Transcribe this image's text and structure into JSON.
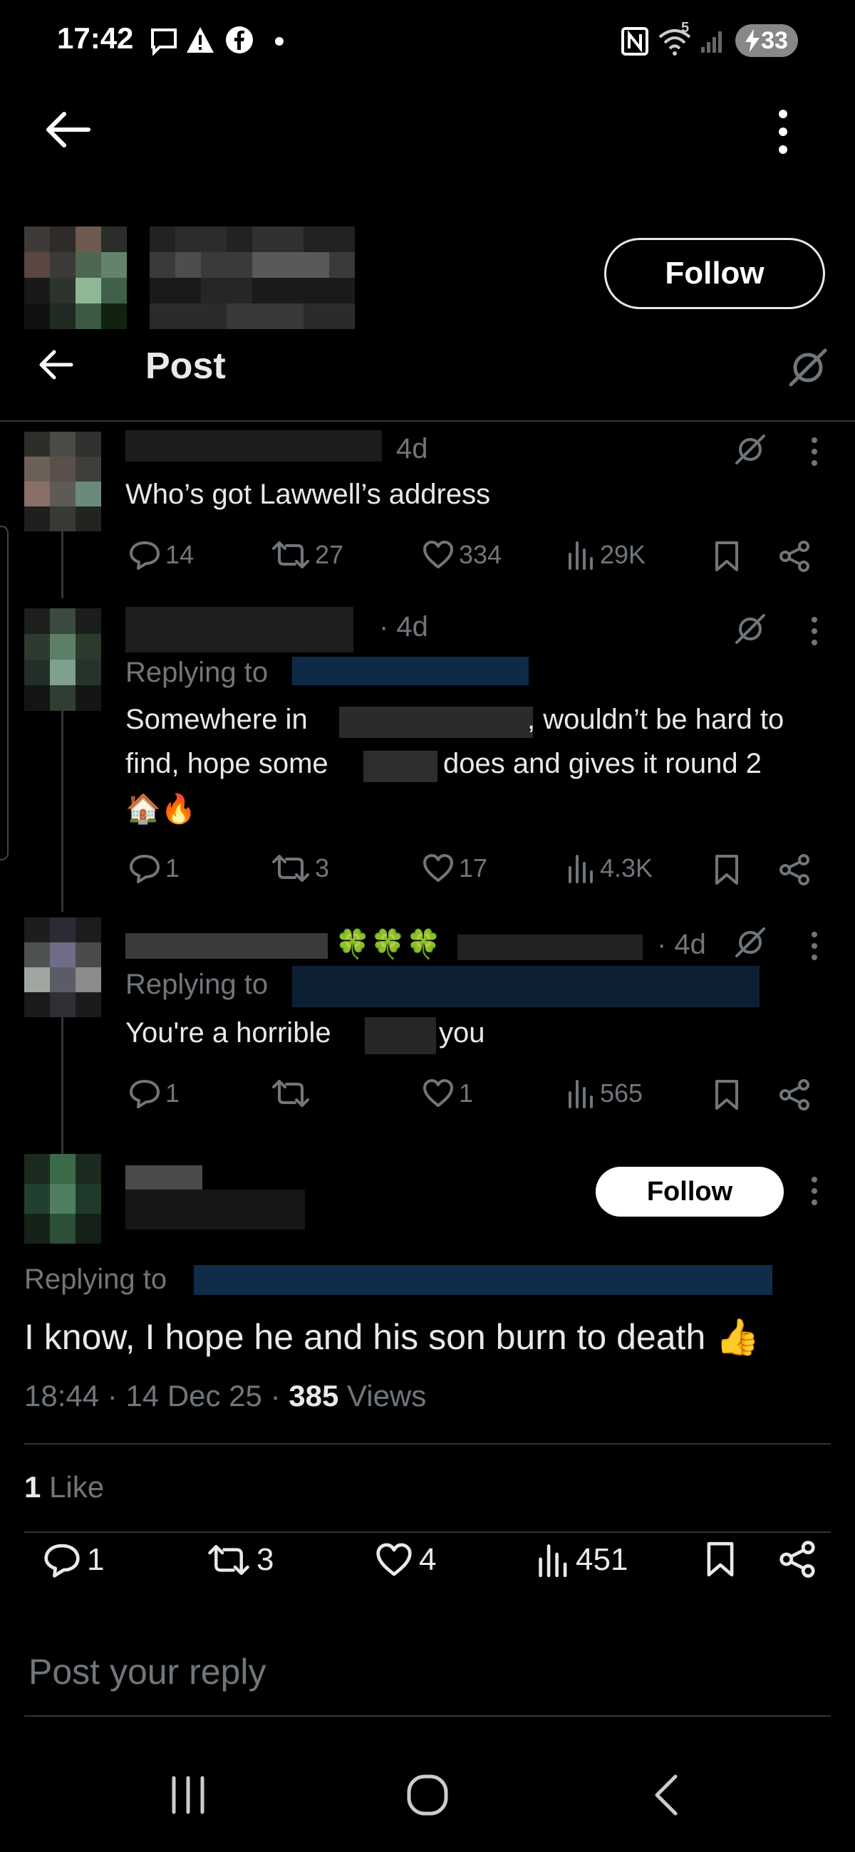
{
  "status_bar": {
    "time": "17:42",
    "battery": "33",
    "net_label": "5"
  },
  "profile_header": {
    "follow_label": "Follow"
  },
  "nav": {
    "title": "Post"
  },
  "thread": [
    {
      "time": "4d",
      "text": "Who’s got Lawwell’s address",
      "stats": {
        "replies": "14",
        "reposts": "27",
        "likes": "334",
        "views": "29K"
      }
    },
    {
      "time": "· 4d",
      "replying_label": "Replying to",
      "text_parts": [
        "Somewhere in",
        ", wouldn’t be hard to",
        "find, hope some",
        "does and gives it round 2"
      ],
      "emoji": "🏠🔥",
      "stats": {
        "replies": "1",
        "reposts": "3",
        "likes": "17",
        "views": "4.3K"
      }
    },
    {
      "time": "· 4d",
      "emoji_name": "🍀🍀🍀",
      "replying_label": "Replying to",
      "text_parts": [
        "You're a horrible",
        "you"
      ],
      "stats": {
        "replies": "1",
        "reposts": "",
        "likes": "1",
        "views": "565"
      }
    }
  ],
  "main_post": {
    "follow_label": "Follow",
    "replying_label": "Replying to",
    "text": "I know, I hope he and his son burn to death 👍",
    "time": "18:44",
    "date": "14 Dec 25",
    "views_count": "385",
    "views_label": "Views",
    "likes_count": "1",
    "likes_label": "Like",
    "stats": {
      "replies": "1",
      "reposts": "3",
      "likes": "4",
      "views": "451"
    }
  },
  "reply_box": {
    "placeholder": "Post your reply"
  }
}
